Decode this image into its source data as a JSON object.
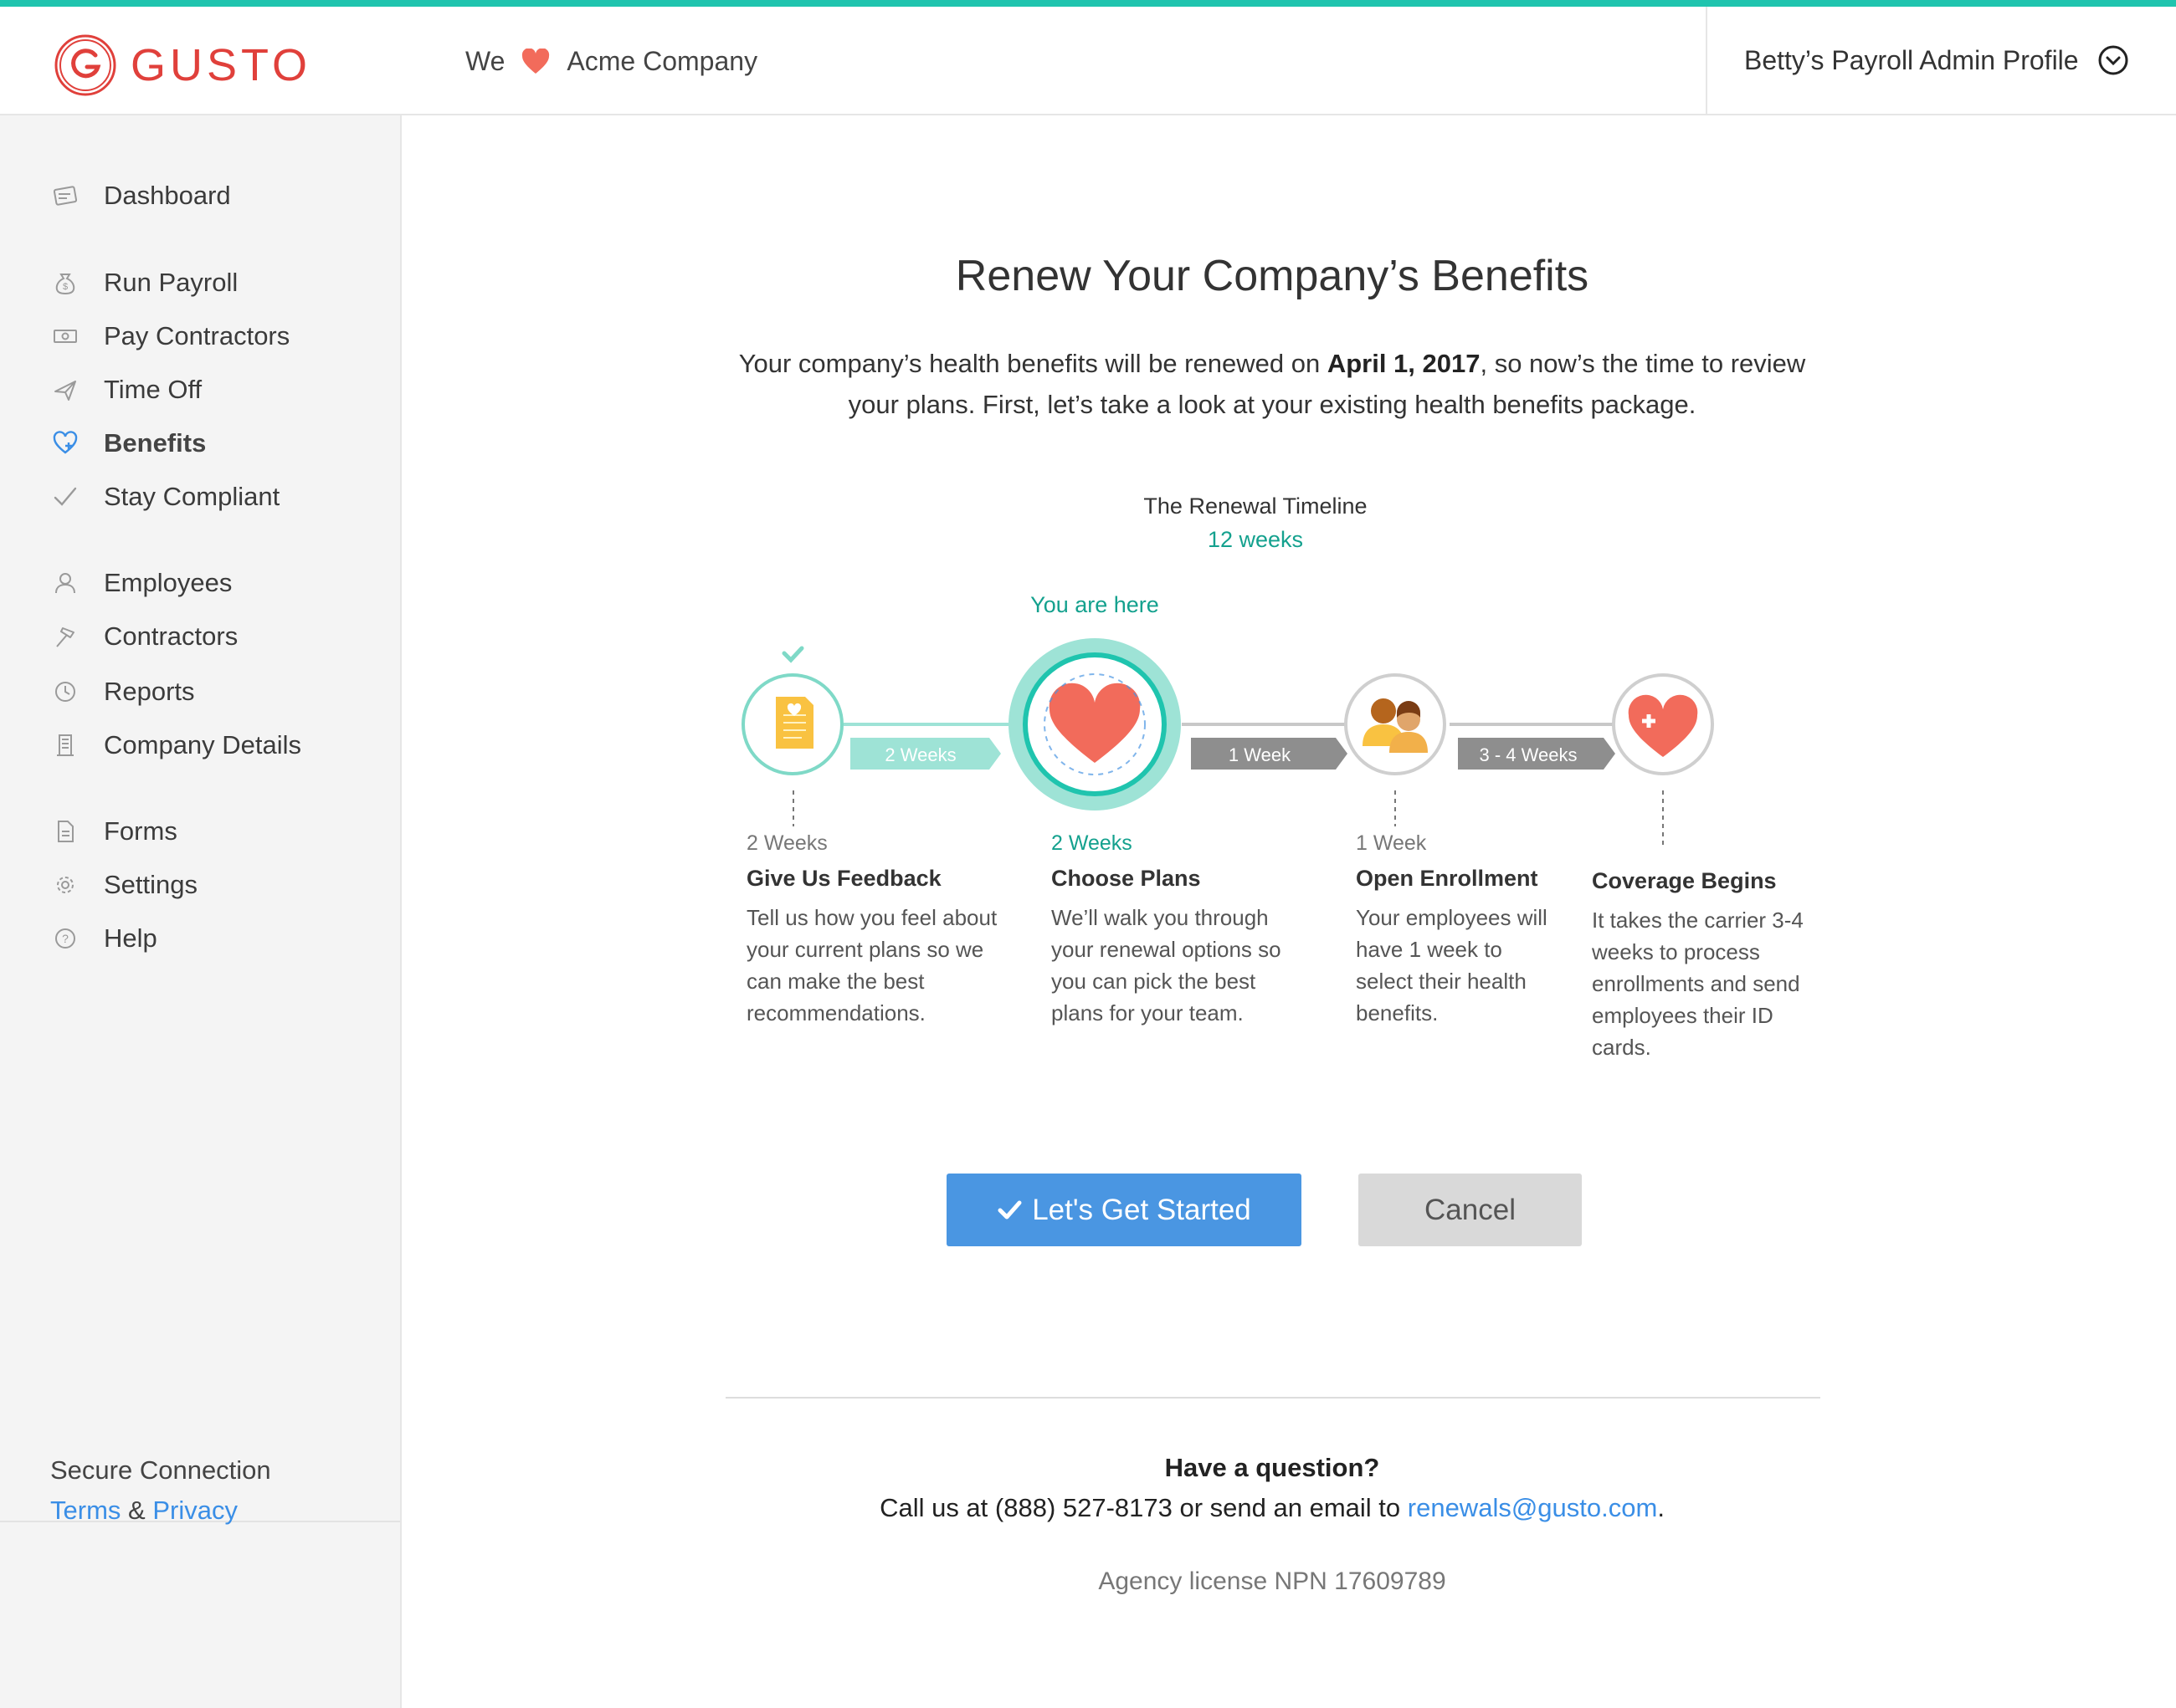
{
  "brand": {
    "name": "GUSTO",
    "color": "#e0403b",
    "accent": "#1fc4ae"
  },
  "header": {
    "tagline_prefix": "We",
    "tagline_icon": "heart-icon",
    "company": "Acme Company",
    "profile_label": "Betty’s Payroll Admin Profile"
  },
  "sidebar": {
    "items": [
      {
        "label": "Dashboard",
        "icon": "dashboard-icon"
      },
      {
        "label": "Run Payroll",
        "icon": "money-bag-icon"
      },
      {
        "label": "Pay Contractors",
        "icon": "cash-icon"
      },
      {
        "label": "Time Off",
        "icon": "airplane-icon"
      },
      {
        "label": "Benefits",
        "icon": "heart-plus-icon",
        "active": true
      },
      {
        "label": "Stay Compliant",
        "icon": "check-icon"
      },
      {
        "label": "Employees",
        "icon": "person-icon"
      },
      {
        "label": "Contractors",
        "icon": "hammer-icon"
      },
      {
        "label": "Reports",
        "icon": "clock-icon"
      },
      {
        "label": "Company Details",
        "icon": "building-icon"
      },
      {
        "label": "Forms",
        "icon": "document-icon"
      },
      {
        "label": "Settings",
        "icon": "gear-icon"
      },
      {
        "label": "Help",
        "icon": "help-icon"
      }
    ],
    "footer": {
      "secure": "Secure Connection",
      "terms": "Terms",
      "and": "&",
      "privacy": "Privacy"
    }
  },
  "main": {
    "title": "Renew Your Company’s Benefits",
    "intro_before": "Your company’s health benefits will be renewed on ",
    "intro_date": "April 1, 2017",
    "intro_after": ", so now’s the time to review your plans. First, let’s take a look at your existing health benefits package.",
    "timeline": {
      "title": "The Renewal Timeline",
      "total": "12 weeks",
      "you_are_here": "You are here",
      "arrows": [
        "2 Weeks",
        "1 Week",
        "3 - 4 Weeks"
      ],
      "steps": [
        {
          "duration": "2 Weeks",
          "name": "Give Us Feedback",
          "desc": "Tell us how you feel about your current plans so we can make the best recommendations.",
          "status": "completed"
        },
        {
          "duration": "2 Weeks",
          "name": "Choose Plans",
          "desc": "We’ll walk you through your renewal options so you can pick the best plans for your team.",
          "status": "current"
        },
        {
          "duration": "1 Week",
          "name": "Open Enrollment",
          "desc": "Your employees will have 1 week to select their health benefits.",
          "status": "upcoming"
        },
        {
          "duration": "",
          "name": "Coverage Begins",
          "desc": "It takes the carrier 3-4 weeks to process enrollments and send employees their ID cards.",
          "status": "upcoming"
        }
      ]
    },
    "buttons": {
      "start": "Let's Get Started",
      "cancel": "Cancel"
    },
    "help": {
      "question": "Have a question?",
      "call_prefix": "Call us at (888) 527-8173 or send an email to ",
      "email": "renewals@gusto.com",
      "call_suffix": ".",
      "license": "Agency license NPN 17609789"
    }
  }
}
